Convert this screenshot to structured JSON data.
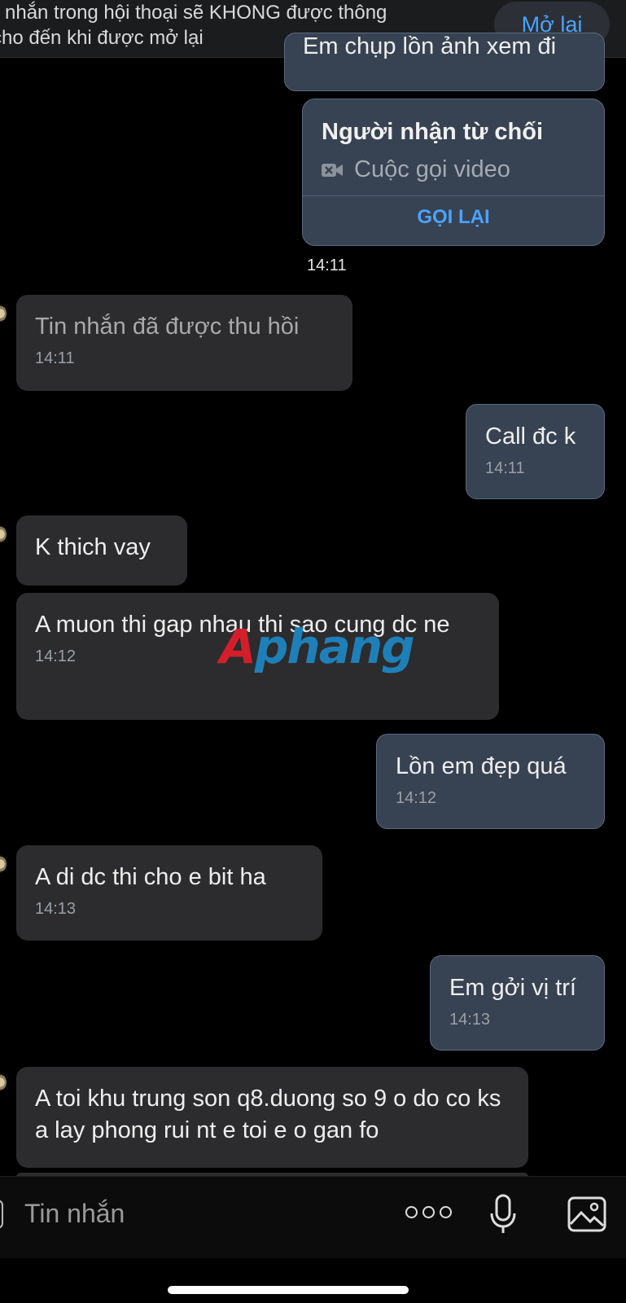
{
  "banner": {
    "line1": "nhắn trong hội thoại sẽ KHONG được thông",
    "line2": "cho đến khi được mở lại",
    "reopen_label": "Mở lại"
  },
  "partial_top_message": "Em chụp lồn ảnh xem đi",
  "call_card": {
    "title": "Người nhận từ chối",
    "type": "Cuộc gọi video",
    "callback_label": "GỌI LẠI",
    "time": "14:11"
  },
  "messages": [
    {
      "direction": "in",
      "text": "Tin nhắn đã được thu hồi",
      "time": "14:11",
      "recalled": true
    },
    {
      "direction": "out",
      "text": "Call đc k",
      "time": "14:11"
    },
    {
      "direction": "in",
      "text": "K thich vay",
      "time": ""
    },
    {
      "direction": "in",
      "text": "A muon thi gap nhau thi sao cung dc ne",
      "time": "14:12"
    },
    {
      "direction": "out",
      "text": "Lồn em đẹp quá",
      "time": "14:12"
    },
    {
      "direction": "in",
      "text": "A di dc thi cho e bit ha",
      "time": "14:13"
    },
    {
      "direction": "out",
      "text": "Em gởi vị trí",
      "time": "14:13"
    },
    {
      "direction": "in",
      "text": "A toi khu trung son q8.duong so 9 o do co ks a lay phong rui nt e toi e o gan fo",
      "time": ""
    }
  ],
  "watermark": {
    "part1": "A",
    "part2": "phang"
  },
  "input": {
    "placeholder": "Tin nhắn"
  },
  "icons": {
    "more": "more-options-icon",
    "mic": "microphone-icon",
    "image": "image-gallery-icon",
    "video": "video-camera-icon"
  },
  "colors": {
    "accent": "#4aa3ff",
    "outgoing_bubble": "#374252",
    "incoming_bubble": "#2c2c2e"
  }
}
